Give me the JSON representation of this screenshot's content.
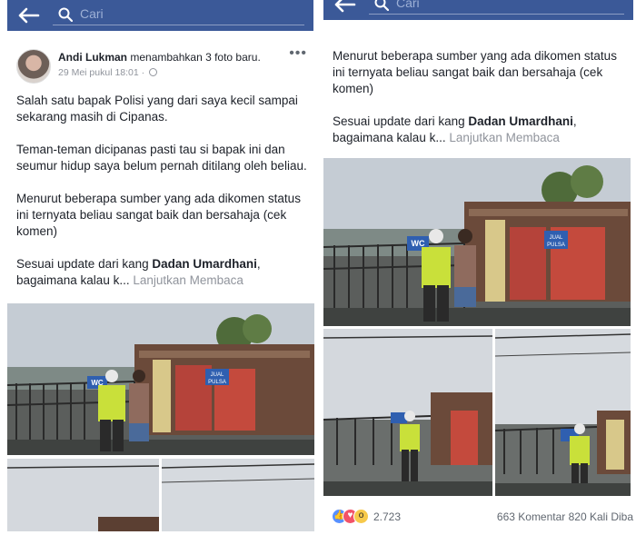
{
  "left": {
    "search": {
      "placeholder": "Cari"
    },
    "post": {
      "author": "Andi Lukman",
      "action": "menambahkan 3 foto baru.",
      "timestamp": "29 Mei pukul 18:01",
      "more": "•••",
      "paragraphs": [
        "Salah satu bapak Polisi yang dari saya kecil sampai sekarang masih di Cipanas.",
        "Teman-teman dicipanas pasti tau si bapak ini dan seumur hidup saya belum pernah ditilang oleh beliau.",
        "Menurut beberapa sumber yang ada dikomen status ini ternyata beliau sangat baik dan bersahaja (cek komen)"
      ],
      "update_prefix": "Sesuai update dari kang ",
      "update_name": "Dadan Umardhani",
      "update_suffix": ", bagaimana kalau k... ",
      "see_more": "Lanjutkan Membaca"
    }
  },
  "right": {
    "search": {
      "placeholder": "Cari"
    },
    "post": {
      "paragraphs": [
        "Menurut beberapa sumber yang ada dikomen status ini ternyata beliau sangat baik dan bersahaja (cek komen)"
      ],
      "update_prefix": "Sesuai update dari kang ",
      "update_name": "Dadan Umardhani",
      "update_suffix": ", bagaimana kalau k... ",
      "see_more": "Lanjutkan Membaca"
    },
    "reactions": {
      "count": "2.723",
      "comments_shares": "663 Komentar  820 Kali Diba"
    }
  },
  "photo_signs": {
    "wc": "WC",
    "wc_sub": "UMUM",
    "jual": "JUAL",
    "pulsa": "PULSA"
  },
  "colors": {
    "facebook_blue": "#3b5998",
    "text": "#1d2129",
    "muted": "#90949c"
  }
}
